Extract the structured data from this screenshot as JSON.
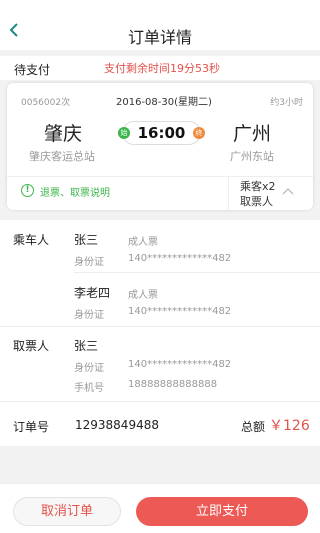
{
  "header": {
    "title": "订单详情",
    "back_icon": "chevron-left-icon"
  },
  "status": {
    "label": "待支付",
    "countdown": "支付剩余时间19分53秒"
  },
  "ticket": {
    "train_no": "0056002次",
    "date": "2016-08-30(星期二)",
    "duration": "约3小时",
    "from_city": "肇庆",
    "to_city": "广州",
    "from_station": "肇庆客运总站",
    "to_station": "广州东站",
    "depart_time": "16:00",
    "start_badge": "始",
    "end_badge": "终",
    "refund_link": "退票、取票说明",
    "passenger_count": "乘客x2",
    "ticket_collector": "取票人"
  },
  "passengers": {
    "section_label": "乘车人",
    "items": [
      {
        "name": "张三",
        "type": "成人票",
        "id_label": "身份证",
        "id_value": "140*************482"
      },
      {
        "name": "李老四",
        "type": "成人票",
        "id_label": "身份证",
        "id_value": "140*************482"
      }
    ]
  },
  "collector": {
    "section_label": "取票人",
    "name": "张三",
    "id_label": "身份证",
    "id_value": "140*************482",
    "phone_label": "手机号",
    "phone_value": "18888888888888"
  },
  "order": {
    "label": "订单号",
    "number": "12938849488",
    "total_label": "总额",
    "total_amount": "￥126"
  },
  "actions": {
    "cancel": "取消订单",
    "pay": "立即支付"
  },
  "colors": {
    "accent": "#ed5a55",
    "green": "#3ab54a",
    "orange": "#f08a3c"
  }
}
